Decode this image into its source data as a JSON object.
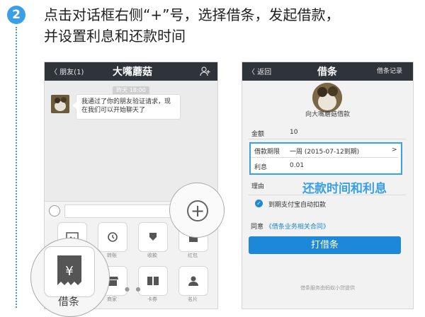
{
  "step": {
    "number": "2",
    "title_line1": "点击对话框右侧“+”号，选择借条，发起借款，",
    "title_line2": "并设置利息和还款时间"
  },
  "chat_screen": {
    "back_label": "〈 朋友(1)",
    "title": "大嘴蘑菇",
    "time_badge": "昨天 18:00",
    "message": "我通过了你的朋友验证请求，现在我们可以开始聊天了",
    "plus_symbol": "+",
    "tiles_row1": [
      {
        "icon": "photo-icon",
        "label": ""
      },
      {
        "icon": "refresh-icon",
        "label": "转账"
      },
      {
        "icon": "download-icon",
        "label": "收款"
      },
      {
        "icon": "gift-icon",
        "label": "红包"
      }
    ],
    "tiles_row2": [
      {
        "icon": "receipt-icon",
        "label": ""
      },
      {
        "icon": "shop-icon",
        "label": "商家"
      },
      {
        "icon": "book-icon",
        "label": "卡券"
      },
      {
        "icon": "person-icon",
        "label": "名片"
      }
    ],
    "jietiao_label": "借条",
    "jietiao_glyph": "¥"
  },
  "loan_screen": {
    "back_label": "〈 返回",
    "title": "借条",
    "records_label": "借条记录",
    "to_user": "向大嘴蘑菇借款",
    "amount_label": "金额",
    "amount_value": "10",
    "term_label": "借款期限",
    "term_value": "一周 (2015-07-12到期)",
    "term_arrow": ">",
    "interest_label": "利息",
    "interest_value": "0.01",
    "reason_label": "理由",
    "annotation": "还款时间和利息",
    "autopay_label": "到期支付宝自动扣款",
    "agree_prefix": "同意",
    "agree_link": "《借条业务相关合同》",
    "submit_label": "打借条",
    "footer": "借条服务由蚂蚁小贷提供"
  },
  "colors": {
    "accent": "#3aa0e6",
    "button_blue": "#1e88d8",
    "navbar": "#2f343b"
  }
}
